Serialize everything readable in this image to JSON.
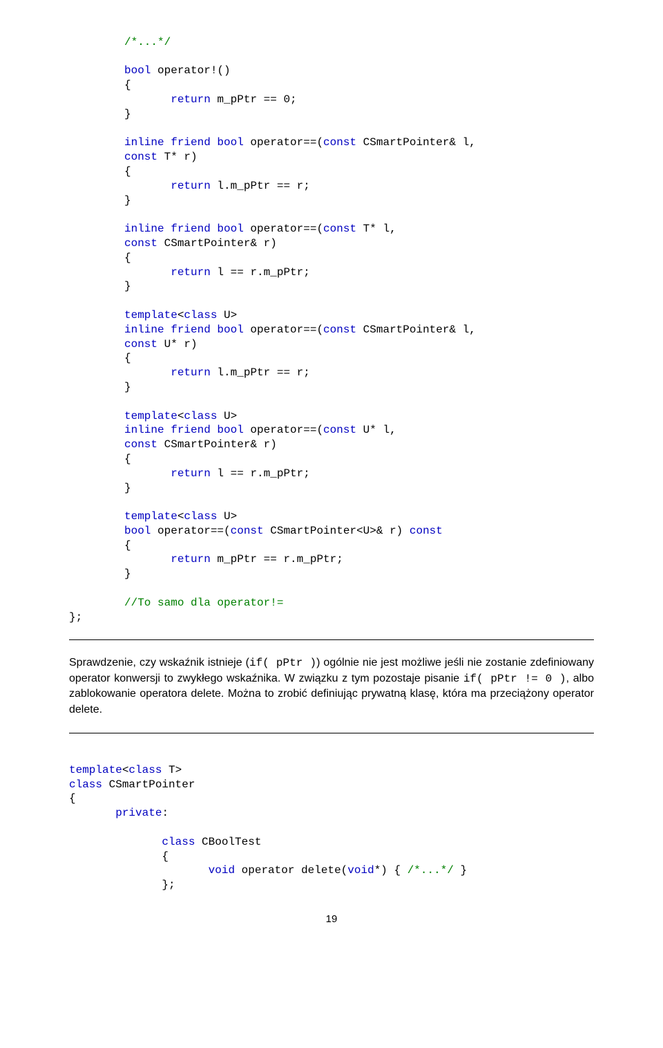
{
  "code1": {
    "l1": "/*...*/",
    "l2": "bool",
    "l2b": " operator!()",
    "l3": "{",
    "l4": "return",
    "l4b": " m_pPtr == 0;",
    "l5": "}",
    "l6a": "inline friend bool",
    "l6b": " operator==(",
    "l6c": "const",
    "l6d": " CSmartPointer& l,",
    "l7a": "const",
    "l7b": " T* r)",
    "l8": "{",
    "l9a": "return",
    "l9b": " l.m_pPtr == r;",
    "l10": "}",
    "l11a": "inline friend bool",
    "l11b": " operator==(",
    "l11c": "const",
    "l11d": " T* l,",
    "l12a": "const",
    "l12b": " CSmartPointer& r)",
    "l13": "{",
    "l14a": "return",
    "l14b": " l == r.m_pPtr;",
    "l15": "}",
    "l16a": "template",
    "l16b": "<",
    "l16c": "class",
    "l16d": " U>",
    "l17a": "inline friend bool",
    "l17b": " operator==(",
    "l17c": "const",
    "l17d": " CSmartPointer& l,",
    "l18a": "const",
    "l18b": " U* r)",
    "l19": "{",
    "l20a": "return",
    "l20b": " l.m_pPtr == r;",
    "l21": "}",
    "l22a": "template",
    "l22b": "<",
    "l22c": "class",
    "l22d": " U>",
    "l23a": "inline friend bool",
    "l23b": " operator==(",
    "l23c": "const",
    "l23d": " U* l,",
    "l24a": "const",
    "l24b": " CSmartPointer& r)",
    "l25": "{",
    "l26a": "return",
    "l26b": " l == r.m_pPtr;",
    "l27": "}",
    "l28a": "template",
    "l28b": "<",
    "l28c": "class",
    "l28d": " U>",
    "l29a": "bool",
    "l29b": " operator==(",
    "l29c": "const",
    "l29d": " CSmartPointer<U>& r) ",
    "l29e": "const",
    "l30": "{",
    "l31a": "return",
    "l31b": " m_pPtr == r.m_pPtr;",
    "l32": "}",
    "l33": "//To samo dla operator!=",
    "l34": "};"
  },
  "prose1": {
    "t1": "Sprawdzenie, czy wskaźnik istnieje (",
    "c1": "if( pPtr )",
    "t2": ") ogólnie nie jest możliwe jeśli nie zostanie zdefiniowany operator konwersji to zwykłego wskaźnika. W związku z tym pozostaje pisanie ",
    "c2": "if( pPtr != 0 )",
    "t3": ", albo zablokowanie operatora delete. Można to zrobić definiując prywatną klasę, która ma przeciążony operator delete."
  },
  "code2": {
    "l1a": "template",
    "l1b": "<",
    "l1c": "class",
    "l1d": " T>",
    "l2a": "class",
    "l2b": " CSmartPointer",
    "l3": "{",
    "l4": "private",
    "l4b": ":",
    "l5a": "class",
    "l5b": " CBoolTest",
    "l6": "{",
    "l7a": "void",
    "l7b": " operator delete(",
    "l7c": "void",
    "l7d": "*) { ",
    "l7e": "/*...*/",
    "l7f": " }",
    "l8": "};"
  },
  "pagenum": "19"
}
